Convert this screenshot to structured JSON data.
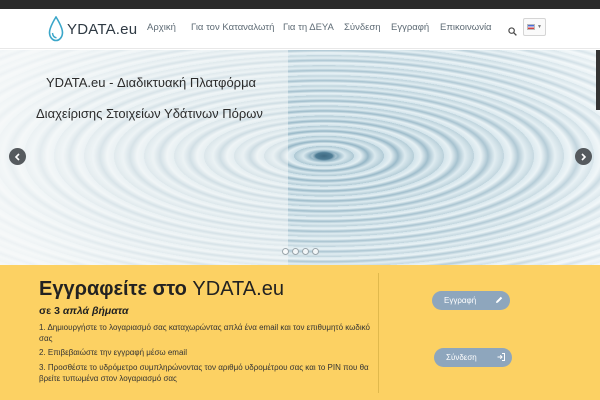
{
  "brand": {
    "name": "YDATA.eu"
  },
  "nav": {
    "items": [
      "Αρχική",
      "Για τον Καταναλωτή",
      "Για τη ΔΕΥΑ",
      "Σύνδεση",
      "Εγγραφή",
      "Επικοινωνία"
    ]
  },
  "icons": {
    "search": "search-icon",
    "language": "greek-flag-icon",
    "prev": "chevron-left-icon",
    "next": "chevron-right-icon"
  },
  "slider": {
    "line1": "YDATA.eu - Διαδικτυακή Πλατφόρμα",
    "line2": "Διαχείρισης Στοιχείων Υδάτινων Πόρων",
    "slide_count": 4
  },
  "register": {
    "title_bold": "Εγγραφείτε στο",
    "title_rest": "YDATA.eu",
    "subtitle_prefix": "σε 3",
    "subtitle_italic": "απλά βήματα",
    "steps": [
      "1. Δημιουργήστε το λογαριασμό σας καταχωρώντας απλά ένα email και τον επιθυμητό κωδικό σας",
      "2. Επιβεβαιώστε την εγγραφή μέσω email",
      "3. Προσθέστε το υδρόμετρο συμπληρώνοντας τον αριθμό υδρομέτρου σας και το PIN που θα βρείτε τυπωμένα στον λογαριασμό σας"
    ],
    "register_button": "Εγγραφή",
    "login_button": "Σύνδεση"
  },
  "colors": {
    "accent_yellow": "#fcd163",
    "button_blue": "#8ea6bd",
    "topbar": "#2b2b2b"
  }
}
